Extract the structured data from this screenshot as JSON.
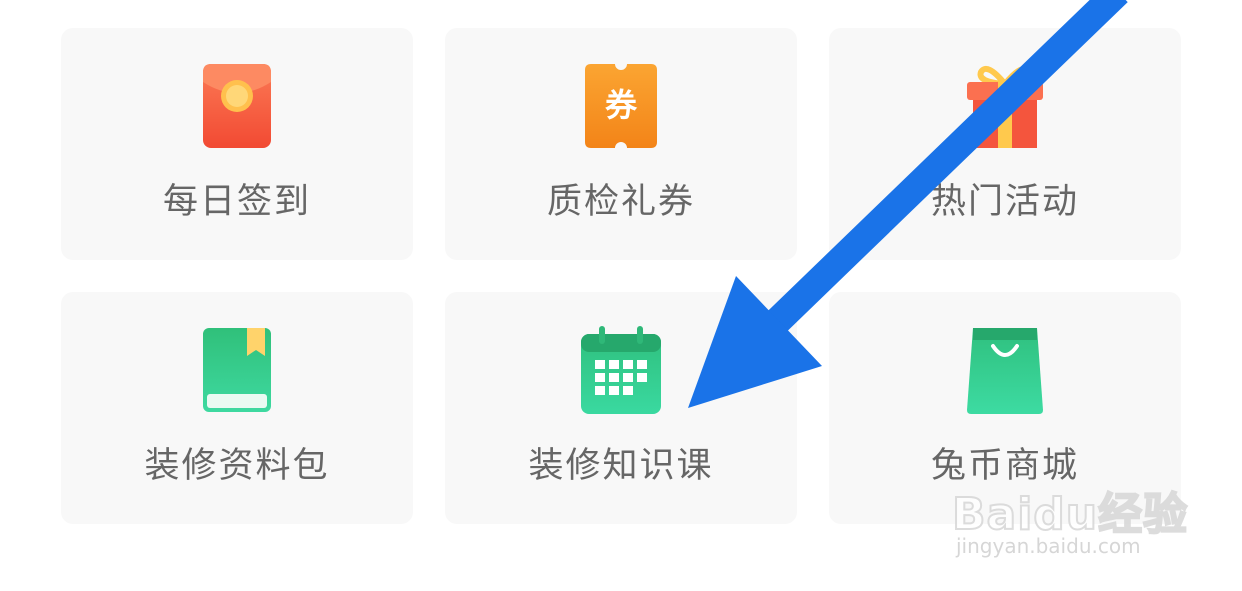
{
  "tiles": [
    {
      "label": "每日签到",
      "icon": "red-envelope-icon"
    },
    {
      "label": "质检礼券",
      "icon": "coupon-icon",
      "icon_text": "券"
    },
    {
      "label": "热门活动",
      "icon": "gift-icon"
    },
    {
      "label": "装修资料包",
      "icon": "book-icon"
    },
    {
      "label": "装修知识课",
      "icon": "calendar-icon"
    },
    {
      "label": "兔币商城",
      "icon": "shopping-bag-icon"
    }
  ],
  "colors": {
    "tile_bg": "#f8f8f8",
    "label": "#666666",
    "arrow": "#1a73e8",
    "red": "#f4533a",
    "orange": "#f6941e",
    "green": "#2ecc8e"
  },
  "watermark": {
    "brand": "Baidu经验",
    "url": "jingyan.baidu.com"
  }
}
